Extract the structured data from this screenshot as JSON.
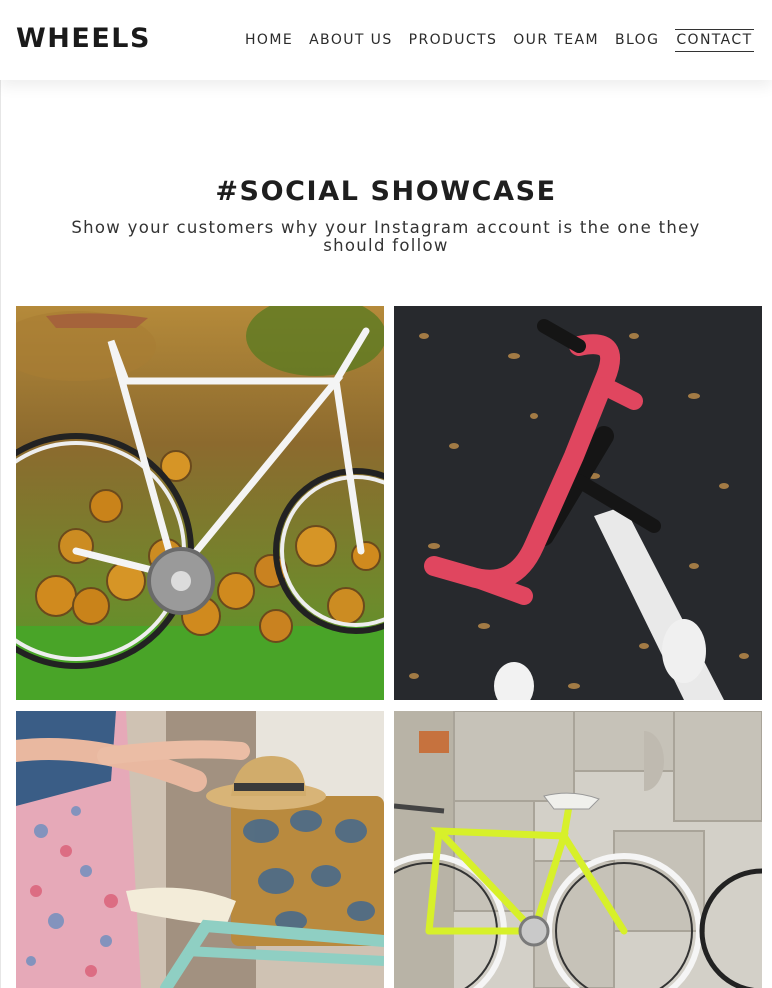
{
  "header": {
    "logo": "WHEELS",
    "nav": [
      "HOME",
      "ABOUT US",
      "PRODUCTS",
      "OUR TEAM",
      "BLOG",
      "CONTACT"
    ],
    "active_nav": "CONTACT"
  },
  "showcase": {
    "title": "#SOCIAL SHOWCASE",
    "subtitle": "Show your customers why your Instagram account is the one they should follow"
  },
  "gallery": [
    {
      "subject": "white-bicycle-by-log-pile"
    },
    {
      "subject": "pink-handlebars-overhead"
    },
    {
      "subject": "woman-with-mint-bicycle"
    },
    {
      "subject": "yellow-bicycle-by-wall"
    }
  ],
  "colors": {
    "text": "#1e1e1e",
    "background": "#ffffff",
    "handlebar": "#e0465f",
    "yellow_frame": "#d7f02a"
  }
}
